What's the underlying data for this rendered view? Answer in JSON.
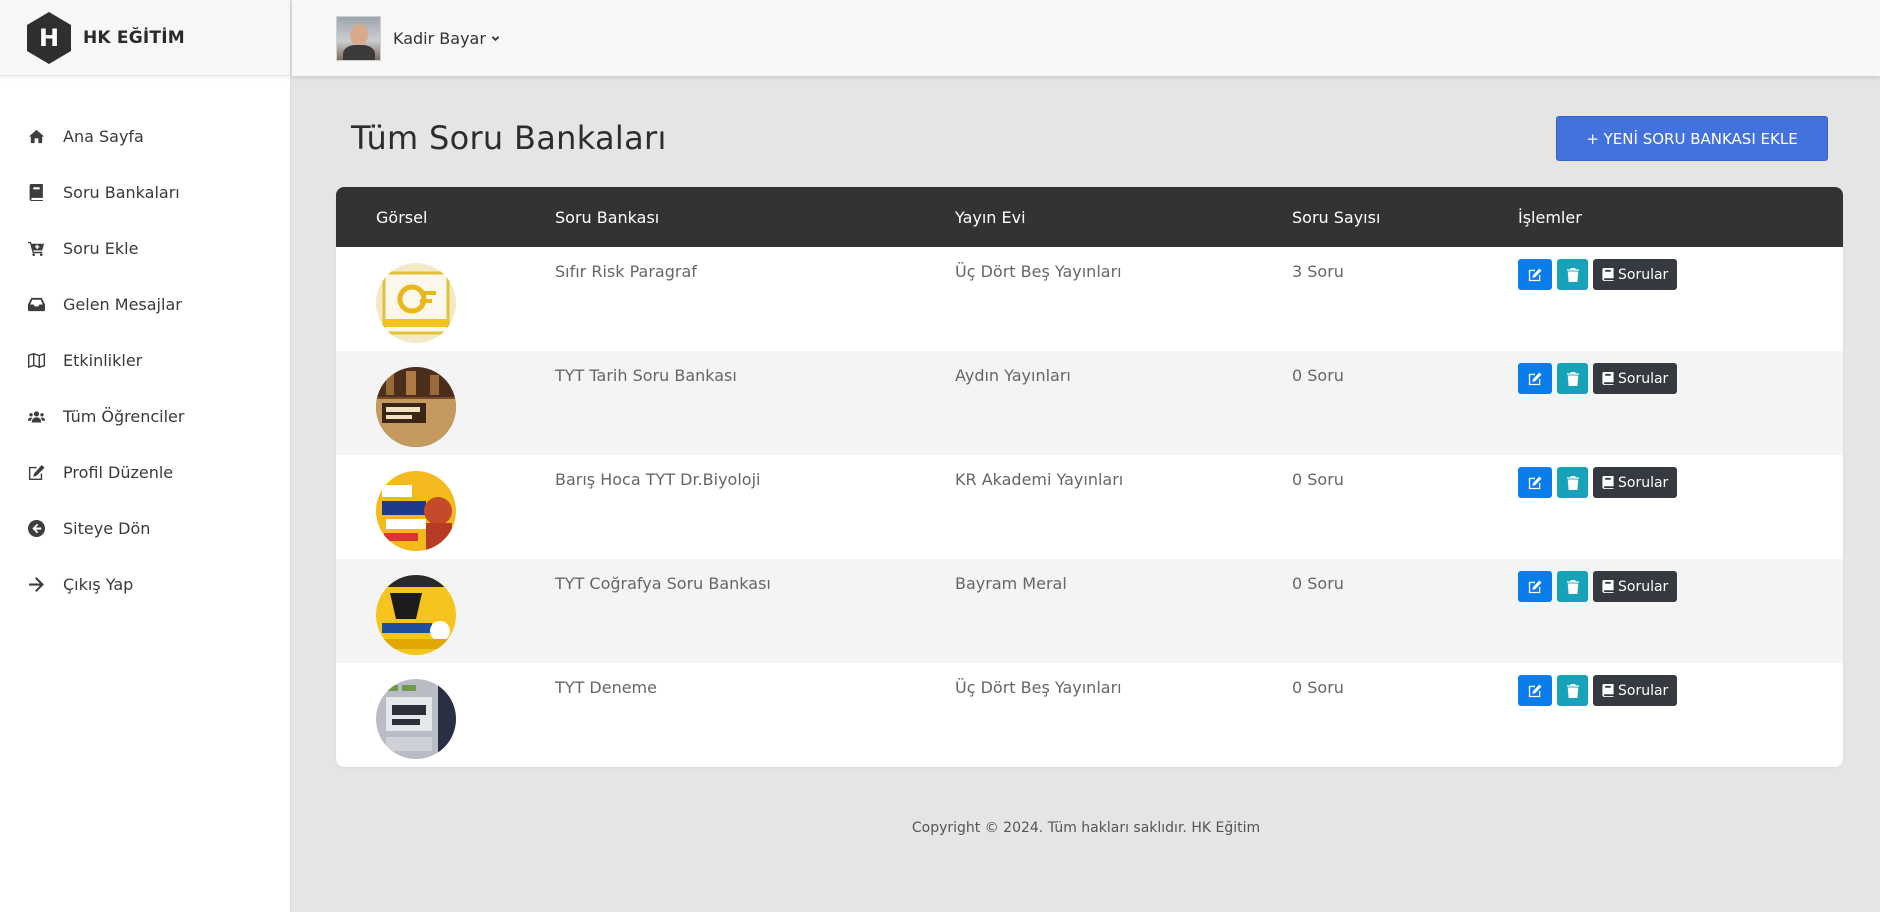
{
  "brand": {
    "letter": "H",
    "name": "HK EĞİTİM"
  },
  "user": {
    "name": "Kadir Bayar"
  },
  "sidebar": {
    "items": [
      {
        "label": "Ana Sayfa",
        "icon": "home-icon"
      },
      {
        "label": "Soru Bankaları",
        "icon": "book-icon"
      },
      {
        "label": "Soru Ekle",
        "icon": "cart-plus-icon"
      },
      {
        "label": "Gelen Mesajlar",
        "icon": "inbox-icon"
      },
      {
        "label": "Etkinlikler",
        "icon": "map-icon"
      },
      {
        "label": "Tüm Öğrenciler",
        "icon": "users-icon"
      },
      {
        "label": "Profil Düzenle",
        "icon": "edit-icon"
      },
      {
        "label": "Siteye Dön",
        "icon": "arrow-circle-left-icon"
      },
      {
        "label": "Çıkış Yap",
        "icon": "arrow-right-icon"
      }
    ]
  },
  "main": {
    "title": "Tüm Soru Bankaları",
    "add_button": "+ YENİ SORU BANKASI EKLE",
    "table": {
      "headers": {
        "image": "Görsel",
        "name": "Soru Bankası",
        "publisher": "Yayın Evi",
        "count": "Soru Sayısı",
        "actions": "İşlemler"
      },
      "rows": [
        {
          "name": "Sıfır Risk Paragraf",
          "publisher": "Üç Dört Beş Yayınları",
          "count": "3 Soru"
        },
        {
          "name": "TYT Tarih Soru Bankası",
          "publisher": "Aydın Yayınları",
          "count": "0 Soru"
        },
        {
          "name": "Barış Hoca TYT Dr.Biyoloji",
          "publisher": "KR Akademi Yayınları",
          "count": "0 Soru"
        },
        {
          "name": "TYT Coğrafya Soru Bankası",
          "publisher": "Bayram Meral",
          "count": "0 Soru"
        },
        {
          "name": "TYT Deneme",
          "publisher": "Üç Dört Beş Yayınları",
          "count": "0 Soru"
        }
      ],
      "questions_button": "Sorular"
    }
  },
  "footer": {
    "text": "Copyright © 2024. Tüm hakları saklıdır. HK Eğitim"
  },
  "colors": {
    "primary": "#4472dc",
    "edit": "#0b7dea",
    "delete": "#17a2b8",
    "dark": "#343a40",
    "header": "#333333"
  }
}
